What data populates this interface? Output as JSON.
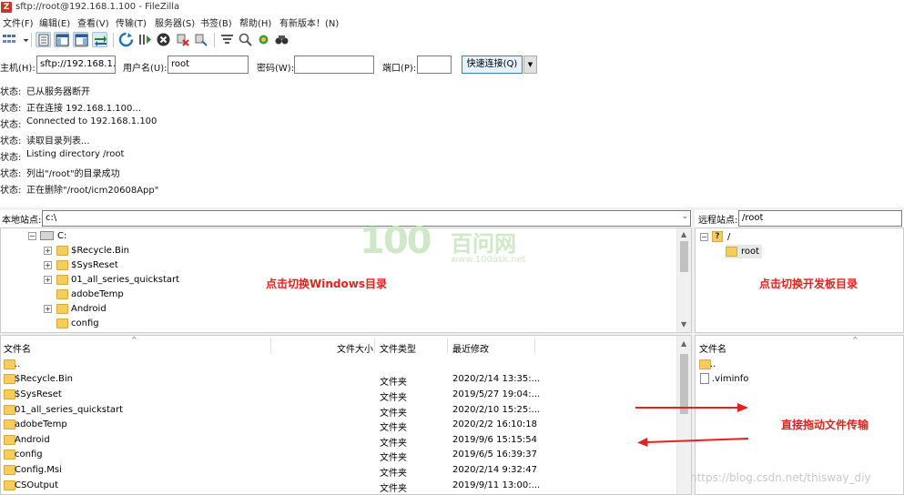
{
  "window": {
    "title": "sftp://root@192.168.1.100 - FileZilla",
    "app_icon": "filezilla-icon"
  },
  "menu": [
    "文件(F)",
    "编辑(E)",
    "查看(V)",
    "传输(T)",
    "服务器(S)",
    "书签(B)",
    "帮助(H)",
    "有新版本！(N)"
  ],
  "toolbar": {
    "icons": [
      "site-manager-icon",
      "site-manager-dropdown-icon",
      "toggle-log-icon",
      "toggle-local-tree-icon",
      "toggle-remote-tree-icon",
      "toggle-queue-icon",
      "refresh-icon",
      "process-queue-icon",
      "cancel-icon",
      "disconnect-icon",
      "reconnect-icon",
      "filter-icon",
      "compare-icon",
      "sync-browse-icon",
      "search-icon"
    ]
  },
  "quickconnect": {
    "host_label": "主机(H):",
    "host_value": "sftp://192.168.1.1(",
    "user_label": "用户名(U):",
    "user_value": "root",
    "password_label": "密码(W):",
    "password_value": "",
    "port_label": "端口(P):",
    "port_value": "",
    "connect_label": "快速连接(Q)"
  },
  "log": [
    {
      "label": "状态:",
      "message": "已从服务器断开"
    },
    {
      "label": "状态:",
      "message": "正在连接 192.168.1.100..."
    },
    {
      "label": "状态:",
      "message": "Connected to 192.168.1.100"
    },
    {
      "label": "状态:",
      "message": "读取目录列表..."
    },
    {
      "label": "状态:",
      "message": "Listing directory /root"
    },
    {
      "label": "状态:",
      "message": "列出\"/root\"的目录成功"
    },
    {
      "label": "状态:",
      "message": "正在删除\"/root/icm20608App\""
    }
  ],
  "local": {
    "site_label": "本地站点:",
    "path": "c:\\",
    "tree": {
      "drive": "C:",
      "folders": [
        "$Recycle.Bin",
        "$SysReset",
        "01_all_series_quickstart",
        "adobeTemp",
        "Android",
        "config"
      ],
      "expandable": [
        true,
        true,
        true,
        false,
        true,
        false
      ]
    },
    "columns": [
      "文件名",
      "文件大小",
      "文件类型",
      "最近修改"
    ],
    "files": [
      {
        "name": "..",
        "type": "",
        "modified": ""
      },
      {
        "name": "$Recycle.Bin",
        "type": "文件夹",
        "modified": "2020/2/14 13:35:..."
      },
      {
        "name": "$SysReset",
        "type": "文件夹",
        "modified": "2019/5/27 19:04:..."
      },
      {
        "name": "01_all_series_quickstart",
        "type": "文件夹",
        "modified": "2020/2/10 15:25:..."
      },
      {
        "name": "adobeTemp",
        "type": "文件夹",
        "modified": "2020/2/2 16:10:18"
      },
      {
        "name": "Android",
        "type": "文件夹",
        "modified": "2019/9/6 15:15:54"
      },
      {
        "name": "config",
        "type": "文件夹",
        "modified": "2019/6/5 16:39:37"
      },
      {
        "name": "Config.Msi",
        "type": "文件夹",
        "modified": "2020/2/14 9:32:47"
      },
      {
        "name": "CSOutput",
        "type": "文件夹",
        "modified": "2019/9/11 13:00:..."
      }
    ]
  },
  "remote": {
    "site_label": "远程站点:",
    "path": "/root",
    "tree": {
      "root_label": "/",
      "child": "root"
    },
    "columns": [
      "文件名"
    ],
    "files": [
      {
        "name": "..",
        "kind": "folder"
      },
      {
        "name": ".viminfo",
        "kind": "file"
      }
    ]
  },
  "annotations": {
    "local_hint": "点击切换Windows目录",
    "remote_hint": "点击切换开发板目录",
    "drag_hint": "直接拖动文件传输",
    "accent_color": "#e8201e"
  },
  "watermark": {
    "number": "100",
    "brand": "百问网",
    "url": "www.100ask.net"
  },
  "csdn_watermark": "https://blog.csdn.net/thisway_diy"
}
